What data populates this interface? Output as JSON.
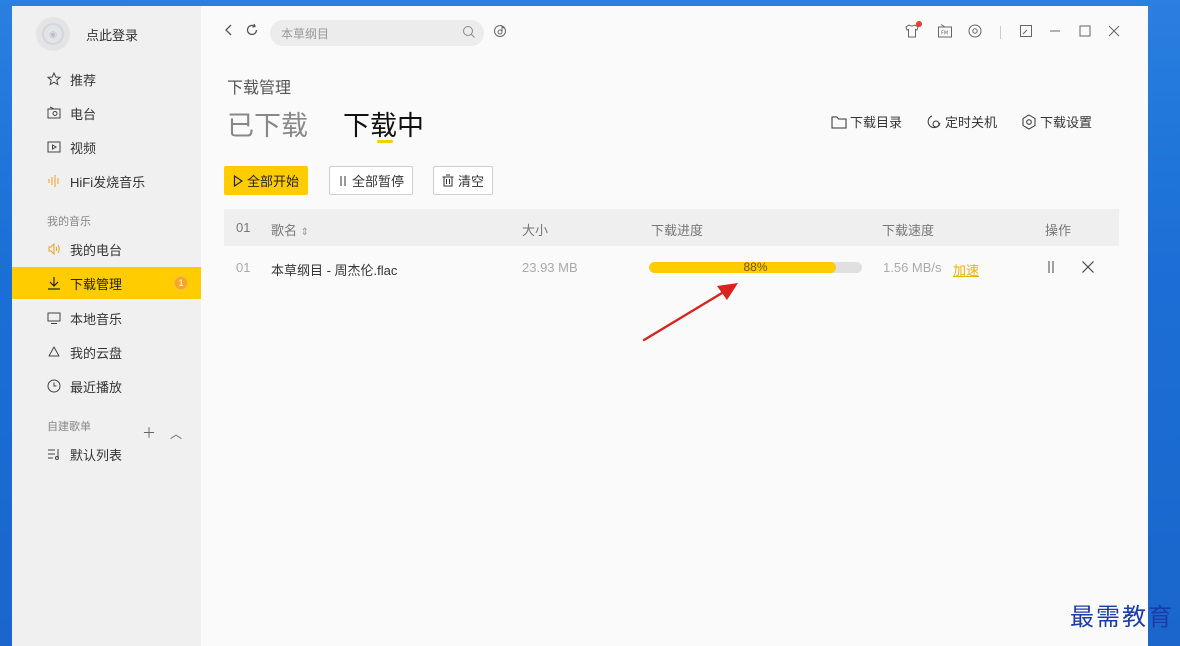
{
  "sidebar": {
    "login_text": "点此登录",
    "items": [
      {
        "label": "推荐",
        "icon": "star-icon"
      },
      {
        "label": "电台",
        "icon": "radio-icon"
      },
      {
        "label": "视频",
        "icon": "video-icon"
      },
      {
        "label": "HiFi发烧音乐",
        "icon": "soundwave-icon"
      }
    ],
    "my_music_label": "我的音乐",
    "my_items": [
      {
        "label": "我的电台",
        "icon": "speaker-icon"
      },
      {
        "label": "下载管理",
        "icon": "download-icon",
        "badge": "1",
        "active": true
      },
      {
        "label": "本地音乐",
        "icon": "monitor-icon"
      },
      {
        "label": "我的云盘",
        "icon": "cloud-icon"
      },
      {
        "label": "最近播放",
        "icon": "clock-icon"
      }
    ],
    "playlist_label": "自建歌单",
    "playlist_items": [
      {
        "label": "默认列表",
        "icon": "playlist-icon"
      }
    ]
  },
  "topbar": {
    "search_placeholder": "本草纲目"
  },
  "main": {
    "page_title": "下载管理",
    "tabs": [
      {
        "label": "已下载",
        "active": false
      },
      {
        "label": "下载中",
        "active": true
      }
    ],
    "links": [
      {
        "label": "下载目录",
        "icon": "folder-icon"
      },
      {
        "label": "定时关机",
        "icon": "timer-icon"
      },
      {
        "label": "下载设置",
        "icon": "settings-icon"
      }
    ],
    "buttons": {
      "start_all": "全部开始",
      "pause_all": "全部暂停",
      "clear": "清空"
    },
    "table": {
      "headers": {
        "index": "01",
        "name": "歌名",
        "size": "大小",
        "progress": "下载进度",
        "speed": "下载速度",
        "ops": "操作"
      },
      "rows": [
        {
          "index": "01",
          "name": "本草纲目 - 周杰伦.flac",
          "size": "23.93 MB",
          "progress_text": "88%",
          "progress": 0.88,
          "speed": "1.56 MB/s",
          "accelerate": "加速"
        }
      ]
    }
  },
  "watermark": "最需教育",
  "colors": {
    "accent": "#ffcc00",
    "badge": "#f5a623",
    "arrow": "#d9231f",
    "desktop": "#1b6fd6"
  }
}
